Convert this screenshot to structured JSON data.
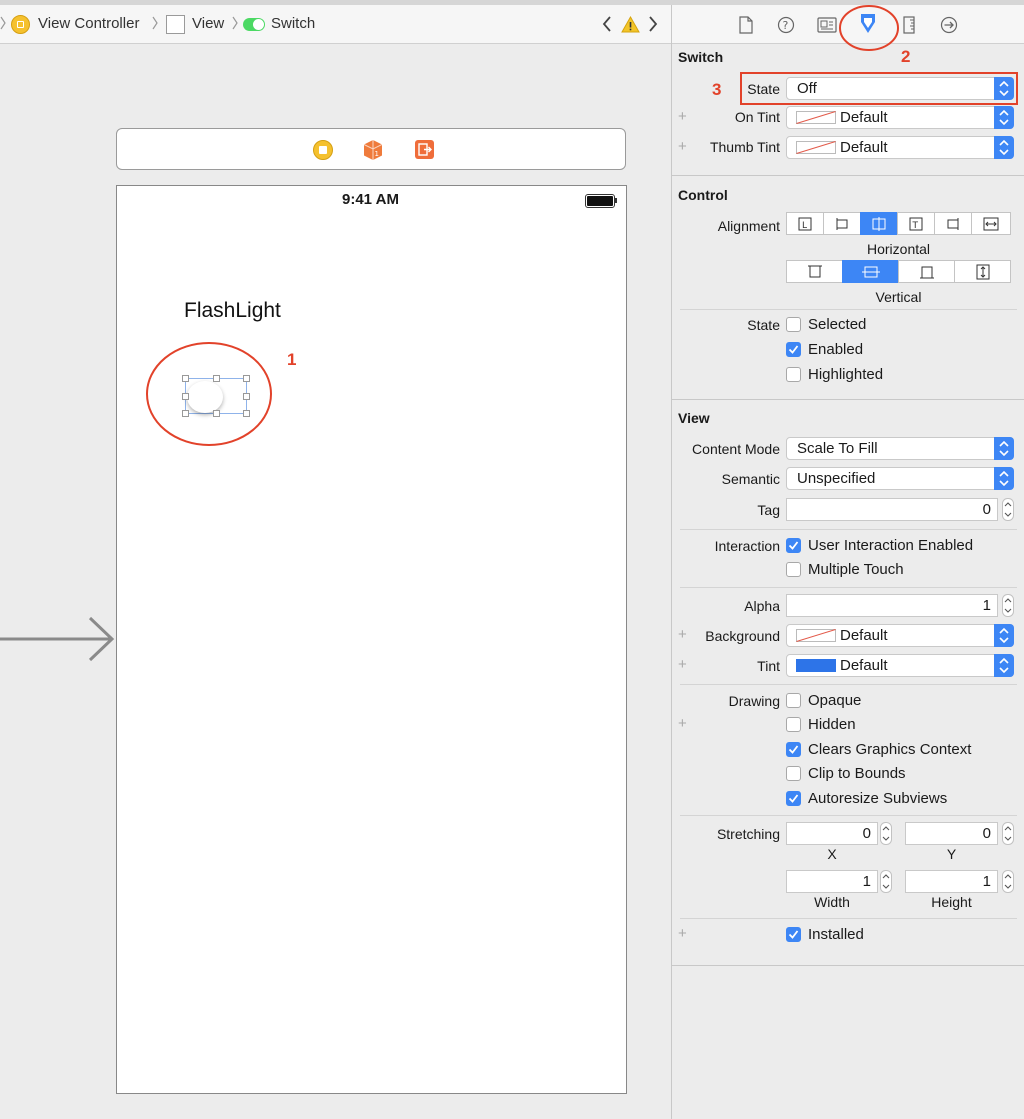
{
  "breadcrumb": {
    "items": [
      "View Controller",
      "View",
      "Switch"
    ]
  },
  "canvas": {
    "status_time": "9:41 AM",
    "label_text": "FlashLight"
  },
  "annotations": {
    "one": "1",
    "two": "2",
    "three": "3"
  },
  "inspector": {
    "switch": {
      "title": "Switch",
      "state_label": "State",
      "state_value": "Off",
      "on_tint_label": "On Tint",
      "on_tint_value": "Default",
      "thumb_tint_label": "Thumb Tint",
      "thumb_tint_value": "Default"
    },
    "control": {
      "title": "Control",
      "alignment_label": "Alignment",
      "horizontal_label": "Horizontal",
      "vertical_label": "Vertical",
      "state_label": "State",
      "selected_label": "Selected",
      "selected": false,
      "enabled_label": "Enabled",
      "enabled": true,
      "highlighted_label": "Highlighted",
      "highlighted": false
    },
    "view": {
      "title": "View",
      "content_mode_label": "Content Mode",
      "content_mode_value": "Scale To Fill",
      "semantic_label": "Semantic",
      "semantic_value": "Unspecified",
      "tag_label": "Tag",
      "tag_value": "0",
      "interaction_label": "Interaction",
      "user_interaction_label": "User Interaction Enabled",
      "user_interaction": true,
      "multiple_touch_label": "Multiple Touch",
      "multiple_touch": false,
      "alpha_label": "Alpha",
      "alpha_value": "1",
      "background_label": "Background",
      "background_value": "Default",
      "tint_label": "Tint",
      "tint_value": "Default",
      "drawing_label": "Drawing",
      "opaque_label": "Opaque",
      "opaque": false,
      "hidden_label": "Hidden",
      "hidden": false,
      "clears_label": "Clears Graphics Context",
      "clears": true,
      "clip_label": "Clip to Bounds",
      "clip": false,
      "autoresize_label": "Autoresize Subviews",
      "autoresize": true,
      "stretching_label": "Stretching",
      "stretch_x": "0",
      "stretch_y": "0",
      "stretch_w": "1",
      "stretch_h": "1",
      "x_label": "X",
      "y_label": "Y",
      "width_label": "Width",
      "height_label": "Height",
      "installed_label": "Installed",
      "installed": true
    }
  },
  "colors": {
    "accent": "#3d86f5",
    "annotation": "#e2422a",
    "tint_swatch": "#2d74e8"
  }
}
